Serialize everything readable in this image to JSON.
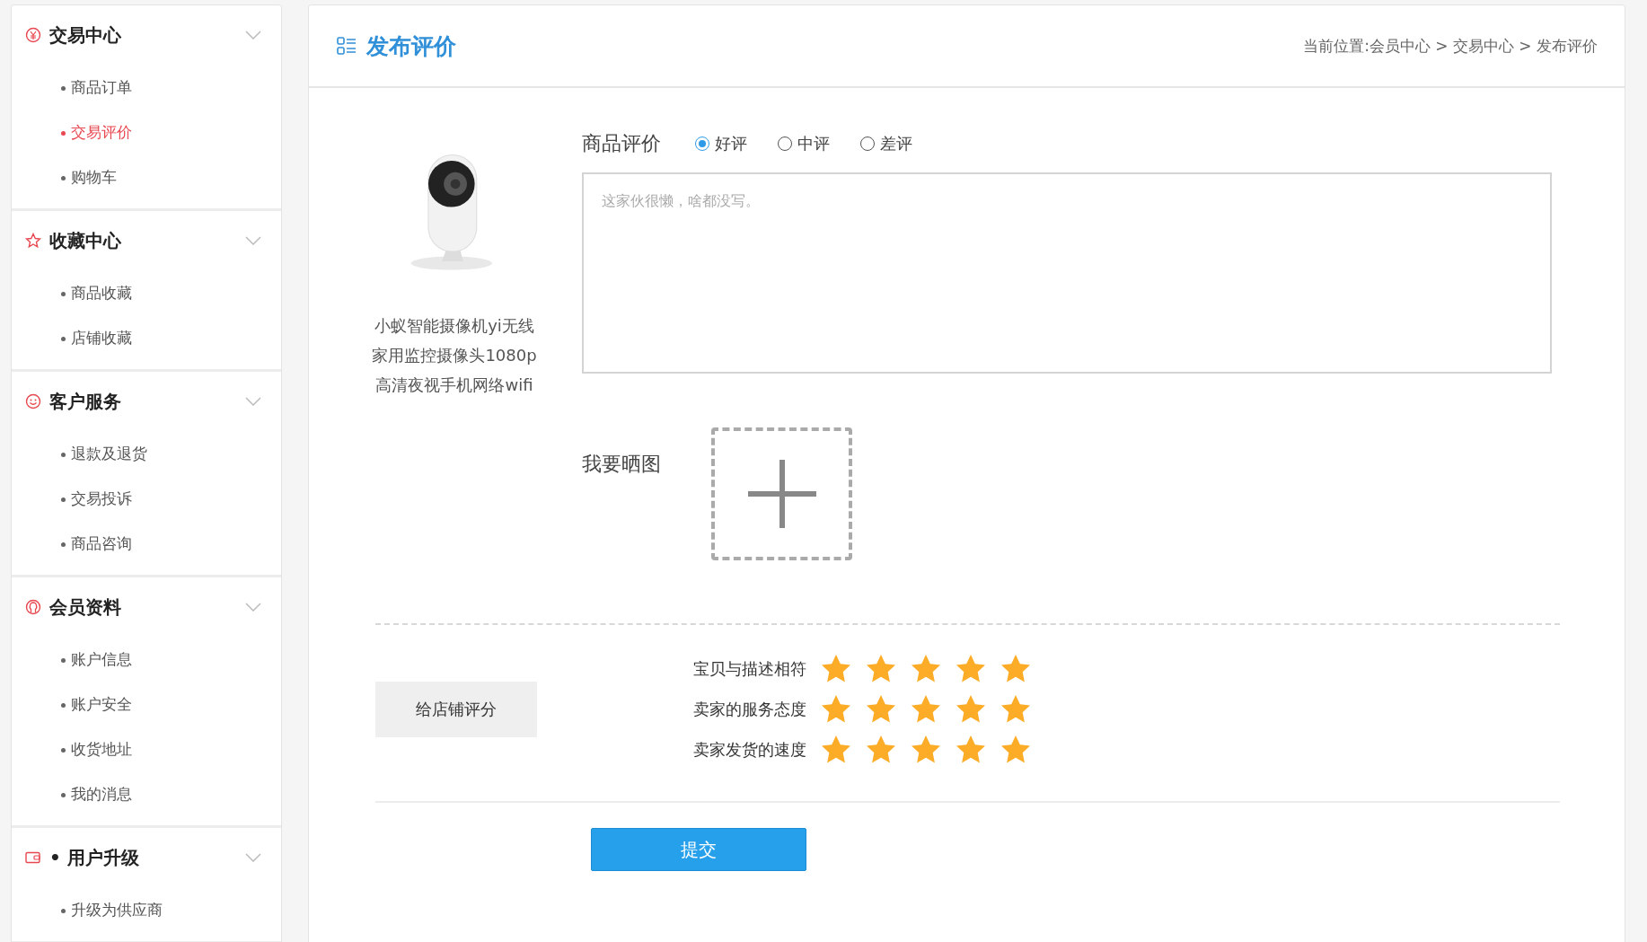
{
  "sidebar": {
    "groups": [
      {
        "title": "交易中心",
        "items": [
          {
            "label": "商品订单",
            "selected": false
          },
          {
            "label": "交易评价",
            "selected": true
          },
          {
            "label": "购物车",
            "selected": false
          }
        ]
      },
      {
        "title": "收藏中心",
        "items": [
          {
            "label": "商品收藏",
            "selected": false
          },
          {
            "label": "店铺收藏",
            "selected": false
          }
        ]
      },
      {
        "title": "客户服务",
        "items": [
          {
            "label": "退款及退货",
            "selected": false
          },
          {
            "label": "交易投诉",
            "selected": false
          },
          {
            "label": "商品咨询",
            "selected": false
          }
        ]
      },
      {
        "title": "会员资料",
        "items": [
          {
            "label": "账户信息",
            "selected": false
          },
          {
            "label": "账户安全",
            "selected": false
          },
          {
            "label": "收货地址",
            "selected": false
          },
          {
            "label": "我的消息",
            "selected": false
          }
        ]
      },
      {
        "title": "• 用户升级",
        "items": [
          {
            "label": "升级为供应商",
            "selected": false
          }
        ]
      }
    ]
  },
  "header": {
    "title": "发布评价",
    "breadcrumb": "当前位置:会员中心 > 交易中心 > 发布评价"
  },
  "product": {
    "name_lines": [
      "小蚁智能摄像机yi无线",
      "家用监控摄像头1080p",
      "高清夜视手机网络wifi"
    ]
  },
  "review": {
    "label": "商品评价",
    "options": [
      {
        "label": "好评",
        "selected": true
      },
      {
        "label": "中评",
        "selected": false
      },
      {
        "label": "差评",
        "selected": false
      }
    ],
    "placeholder": "这家伙很懒，啥都没写。"
  },
  "photos": {
    "label": "我要晒图"
  },
  "shop_rating": {
    "label": "给店铺评分",
    "rows": [
      {
        "label": "宝贝与描述相符",
        "stars": 5
      },
      {
        "label": "卖家的服务态度",
        "stars": 5
      },
      {
        "label": "卖家发货的速度",
        "stars": 5
      }
    ]
  },
  "submit": "提交"
}
